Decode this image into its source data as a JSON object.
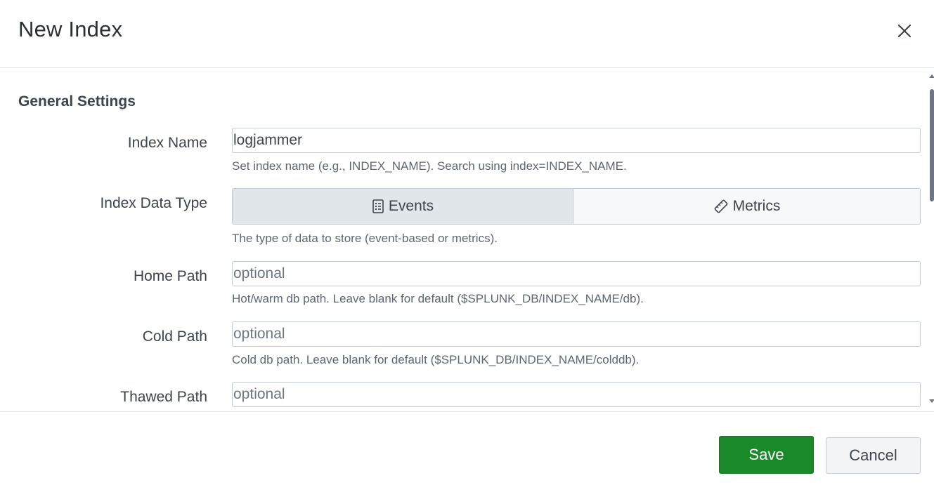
{
  "dialog": {
    "title": "New Index"
  },
  "general": {
    "section_title": "General Settings",
    "index_name": {
      "label": "Index Name",
      "value": "logjammer",
      "help": "Set index name (e.g., INDEX_NAME). Search using index=INDEX_NAME."
    },
    "data_type": {
      "label": "Index Data Type",
      "options": [
        "Events",
        "Metrics"
      ],
      "selected": "Events",
      "help": "The type of data to store (event-based or metrics)."
    },
    "home_path": {
      "label": "Home Path",
      "placeholder": "optional",
      "help": "Hot/warm db path. Leave blank for default ($SPLUNK_DB/INDEX_NAME/db)."
    },
    "cold_path": {
      "label": "Cold Path",
      "placeholder": "optional",
      "help": "Cold db path. Leave blank for default ($SPLUNK_DB/INDEX_NAME/colddb)."
    },
    "thawed_path": {
      "label": "Thawed Path",
      "placeholder": "optional"
    }
  },
  "footer": {
    "save_label": "Save",
    "cancel_label": "Cancel"
  },
  "colors": {
    "save_bg": "#1a8929",
    "border": "#c3cbd4",
    "text": "#3c444d",
    "active_segment": "#e1e6eb"
  },
  "icons": {
    "close": "close-icon",
    "events": "document-list-icon",
    "metrics": "ruler-icon"
  }
}
